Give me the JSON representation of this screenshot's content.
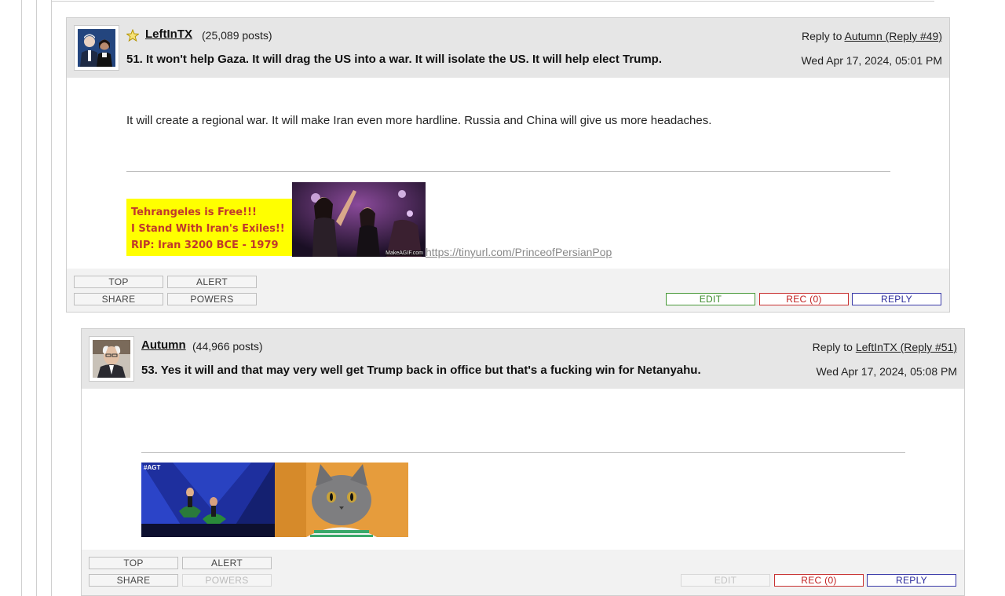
{
  "posts": [
    {
      "username": "LeftInTX",
      "post_count": "(25,089 posts)",
      "subject": "51. It won't help Gaza. It will drag the US into a war. It will isolate the US. It will help elect Trump.",
      "reply_prefix": "Reply to",
      "reply_link": "Autumn (Reply #49)",
      "timestamp": "Wed Apr 17, 2024, 05:01 PM",
      "body": "It will create a regional war. It will make Iran even more hardline. Russia and China will give us more headaches.",
      "banner_lines": [
        "Tehrangeles is Free!!!",
        "I Stand With Iran's Exiles!!",
        "RIP: Iran 3200 BCE - 1979"
      ],
      "gif_watermark": "MakeAGIF.com",
      "sig_link": "https://tinyurl.com/PrinceofPersianPop",
      "buttons": {
        "top": "TOP",
        "alert": "ALERT",
        "share": "SHARE",
        "powers": "POWERS",
        "edit": "EDIT",
        "rec": "REC (0)",
        "reply": "REPLY"
      },
      "icons": {
        "favorite": "star-icon"
      }
    },
    {
      "username": "Autumn",
      "post_count": "(44,966 posts)",
      "subject": "53. Yes it will and that may very well get Trump back in office but that's a fucking win for Netanyahu.",
      "reply_prefix": "Reply to",
      "reply_link": "LeftInTX (Reply #51)",
      "timestamp": "Wed Apr 17, 2024, 05:08 PM",
      "gif_label": "#AGT",
      "buttons": {
        "top": "TOP",
        "alert": "ALERT",
        "share": "SHARE",
        "powers": "POWERS",
        "edit": "EDIT",
        "rec": "REC (0)",
        "reply": "REPLY"
      }
    }
  ],
  "colors": {
    "header_bg": "#e6e6e6",
    "edit": "#3a8a2a",
    "rec": "#c02020",
    "reply": "#2a2a9a",
    "banner_bg": "#ffff00",
    "banner_text": "#c0392b"
  }
}
